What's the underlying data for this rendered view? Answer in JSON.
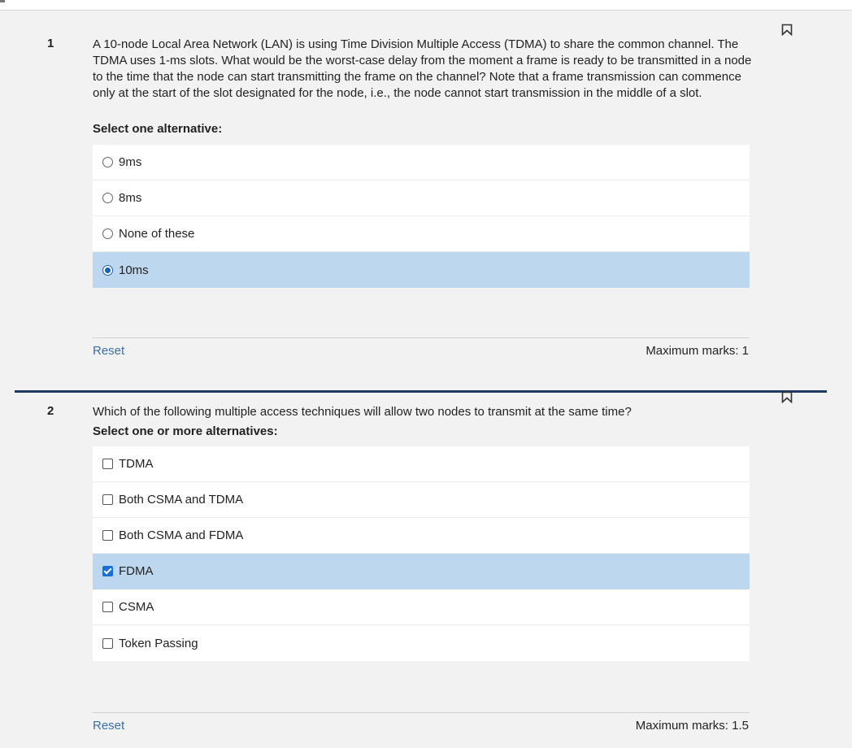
{
  "questions": [
    {
      "number": "1",
      "text": "A 10-node Local Area Network (LAN) is using Time Division Multiple Access (TDMA) to share the common channel. The TDMA uses 1-ms slots. What would be the worst-case delay from the moment a frame is ready to be transmitted in a node to the time that the node can start transmitting the frame on the channel? Note that a frame transmission can commence only at the start of the slot designated for the node, i.e., the node cannot start transmission in the middle of a slot.",
      "instruction": "Select one alternative:",
      "options": [
        {
          "label": "9ms",
          "selected": false
        },
        {
          "label": "8ms",
          "selected": false
        },
        {
          "label": "None of these",
          "selected": false
        },
        {
          "label": "10ms",
          "selected": true
        }
      ],
      "reset_label": "Reset",
      "marks_label": "Maximum marks: 1"
    },
    {
      "number": "2",
      "text": "Which of the following multiple access techniques will allow two nodes to transmit at the same time?",
      "instruction": "Select one or more alternatives:",
      "options": [
        {
          "label": "TDMA",
          "selected": false
        },
        {
          "label": "Both CSMA and TDMA",
          "selected": false
        },
        {
          "label": "Both CSMA and FDMA",
          "selected": false
        },
        {
          "label": "FDMA",
          "selected": true
        },
        {
          "label": "CSMA",
          "selected": false
        },
        {
          "label": "Token Passing",
          "selected": false
        }
      ],
      "reset_label": "Reset",
      "marks_label": "Maximum marks: 1.5"
    }
  ],
  "icons": {
    "bookmark": "bookmark-flag-icon"
  },
  "colors": {
    "selected_bg": "#bdd7ee",
    "divider": "#1f3a60",
    "link": "#3b6fa8",
    "accent": "#1a6fd0"
  }
}
